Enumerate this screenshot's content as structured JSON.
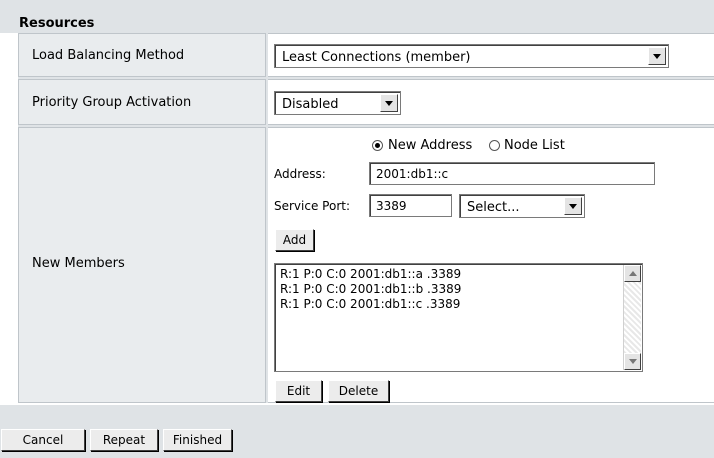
{
  "section": {
    "title": "Resources"
  },
  "rows": {
    "load_balancing": {
      "label": "Load Balancing Method",
      "value": "Least Connections (member)"
    },
    "priority_group": {
      "label": "Priority Group Activation",
      "value": "Disabled"
    },
    "new_members": {
      "label": "New Members",
      "radio_new_address": "New Address",
      "radio_node_list": "Node List",
      "selected_radio": "New Address",
      "address_label": "Address:",
      "address_value": "2001:db1::c",
      "service_port_label": "Service Port:",
      "service_port_value": "3389",
      "service_select_value": "Select...",
      "add_button": "Add",
      "members": [
        "R:1 P:0 C:0 2001:db1::a .3389",
        "R:1 P:0 C:0 2001:db1::b .3389",
        "R:1 P:0 C:0 2001:db1::c .3389"
      ],
      "edit_button": "Edit",
      "delete_button": "Delete"
    }
  },
  "footer": {
    "cancel_button": "Cancel",
    "repeat_button": "Repeat",
    "finished_button": "Finished"
  }
}
